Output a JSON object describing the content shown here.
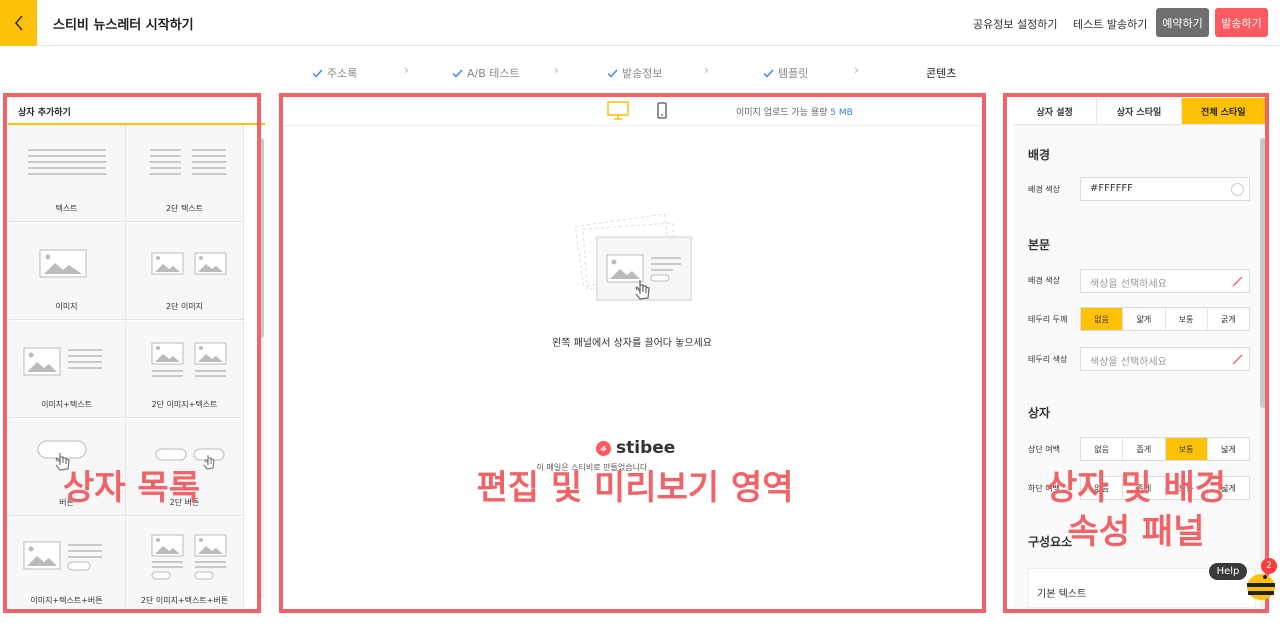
{
  "header": {
    "title": "스티비 뉴스레터 시작하기",
    "links": [
      "공유정보 설정하기",
      "테스트 발송하기"
    ],
    "reserve_label": "예약하기",
    "send_label": "발송하기"
  },
  "steps": [
    {
      "label": "주소록",
      "done": true
    },
    {
      "label": "A/B 테스트",
      "done": true
    },
    {
      "label": "발송정보",
      "done": true
    },
    {
      "label": "템플릿",
      "done": true
    },
    {
      "label": "콘텐츠",
      "done": false
    }
  ],
  "left_panel": {
    "title": "상자 추가하기",
    "tiles": [
      {
        "label": "텍스트",
        "icon": "text-icon"
      },
      {
        "label": "2단 텍스트",
        "icon": "two-column-text-icon"
      },
      {
        "label": "이미지",
        "icon": "image-icon"
      },
      {
        "label": "2단 이미지",
        "icon": "two-column-image-icon"
      },
      {
        "label": "이미지+텍스트",
        "icon": "image-text-icon"
      },
      {
        "label": "2단 이미지+텍스트",
        "icon": "two-column-image-text-icon"
      },
      {
        "label": "버튼",
        "icon": "button-icon"
      },
      {
        "label": "2단 버튼",
        "icon": "two-column-button-icon"
      },
      {
        "label": "이미지+텍스트+버튼",
        "icon": "image-text-button-icon"
      },
      {
        "label": "2단 이미지+텍스트+버튼",
        "icon": "two-column-image-text-button-icon"
      }
    ]
  },
  "center": {
    "upload_prefix": "이미지 업로드 가능 용량",
    "upload_size": "5 MB",
    "drop_message": "왼쪽 패널에서 상자를 끌어다 놓으세요",
    "brand": "stibee",
    "made_by": "이 메일은 스티비로 만들었습니다"
  },
  "right_panel": {
    "tabs": [
      "상자 설정",
      "상자 스타일",
      "전체 스타일"
    ],
    "active_tab": 2,
    "background": {
      "title": "배경",
      "color_label": "배경 색상",
      "color_value": "#FFFFFF"
    },
    "body": {
      "title": "본문",
      "bg_color_label": "배경 색상",
      "bg_color_placeholder": "색상을 선택하세요",
      "border_width_label": "테두리 두께",
      "border_options": [
        "없음",
        "얇게",
        "보통",
        "굵게"
      ],
      "border_selected": 0,
      "border_color_label": "테두리 색상",
      "border_color_placeholder": "색상을 선택하세요"
    },
    "box": {
      "title": "상자",
      "top_margin_label": "상단 여백",
      "top_margin_options": [
        "없음",
        "좁게",
        "보통",
        "넓게"
      ],
      "top_margin_selected": 2,
      "bottom_margin_label": "하단 여백",
      "bottom_margin_options": [
        "없음",
        "좁게",
        "보통",
        "넓게"
      ]
    },
    "components": {
      "title": "구성요소",
      "first_item": "기본 텍스트"
    }
  },
  "annotations": {
    "left": "상자 목록",
    "center": "편집 및 미리보기 영역",
    "right_line1": "상자 및 배경",
    "right_line2": "속성 패널"
  },
  "help": {
    "label": "Help",
    "badge": "2"
  },
  "colors": {
    "accent": "#ffc107",
    "send": "#ff5a5f",
    "reserve": "#6f6f6f",
    "annotation": "#f06468"
  }
}
